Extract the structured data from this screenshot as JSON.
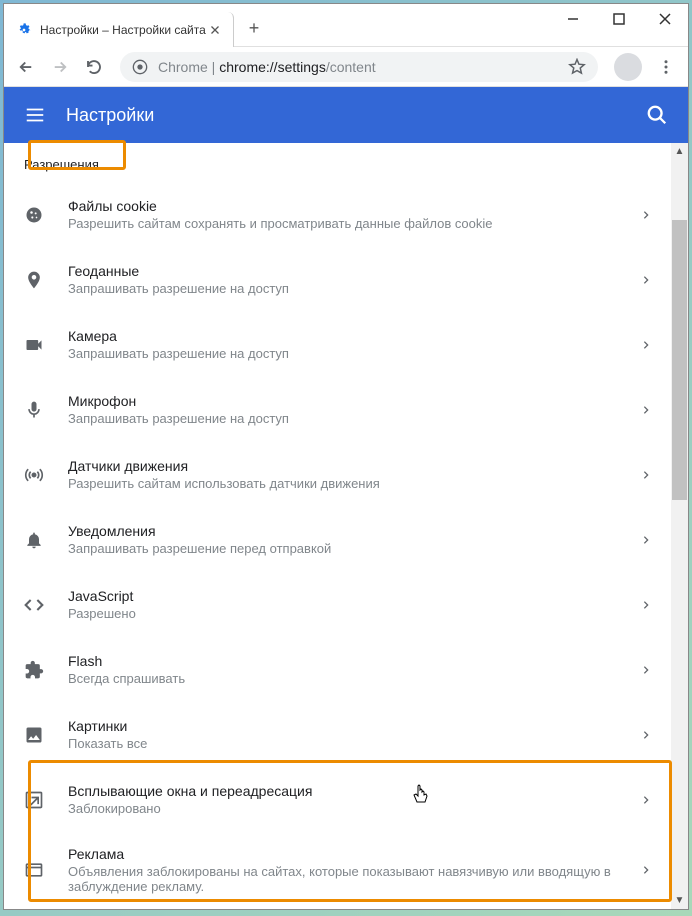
{
  "tab": {
    "title": "Настройки – Настройки сайта"
  },
  "address": {
    "prefix": "Chrome",
    "separator": " | ",
    "url_dark": "chrome://settings",
    "url_light": "/content"
  },
  "header": {
    "title": "Настройки"
  },
  "section": {
    "title": "Разрешения"
  },
  "rows": [
    {
      "icon": "cookie",
      "title": "Файлы cookie",
      "sub": "Разрешить сайтам сохранять и просматривать данные файлов cookie"
    },
    {
      "icon": "location",
      "title": "Геоданные",
      "sub": "Запрашивать разрешение на доступ"
    },
    {
      "icon": "camera",
      "title": "Камера",
      "sub": "Запрашивать разрешение на доступ"
    },
    {
      "icon": "mic",
      "title": "Микрофон",
      "sub": "Запрашивать разрешение на доступ"
    },
    {
      "icon": "sensors",
      "title": "Датчики движения",
      "sub": "Разрешить сайтам использовать датчики движения"
    },
    {
      "icon": "bell",
      "title": "Уведомления",
      "sub": "Запрашивать разрешение перед отправкой"
    },
    {
      "icon": "code",
      "title": "JavaScript",
      "sub": "Разрешено"
    },
    {
      "icon": "extension",
      "title": "Flash",
      "sub": "Всегда спрашивать"
    },
    {
      "icon": "image",
      "title": "Картинки",
      "sub": "Показать все"
    },
    {
      "icon": "popup",
      "title": "Всплывающие окна и переадресация",
      "sub": "Заблокировано"
    },
    {
      "icon": "ads",
      "title": "Реклама",
      "sub": "Объявления заблокированы на сайтах, которые показывают навязчивую или вводящую в заблуждение рекламу."
    }
  ]
}
